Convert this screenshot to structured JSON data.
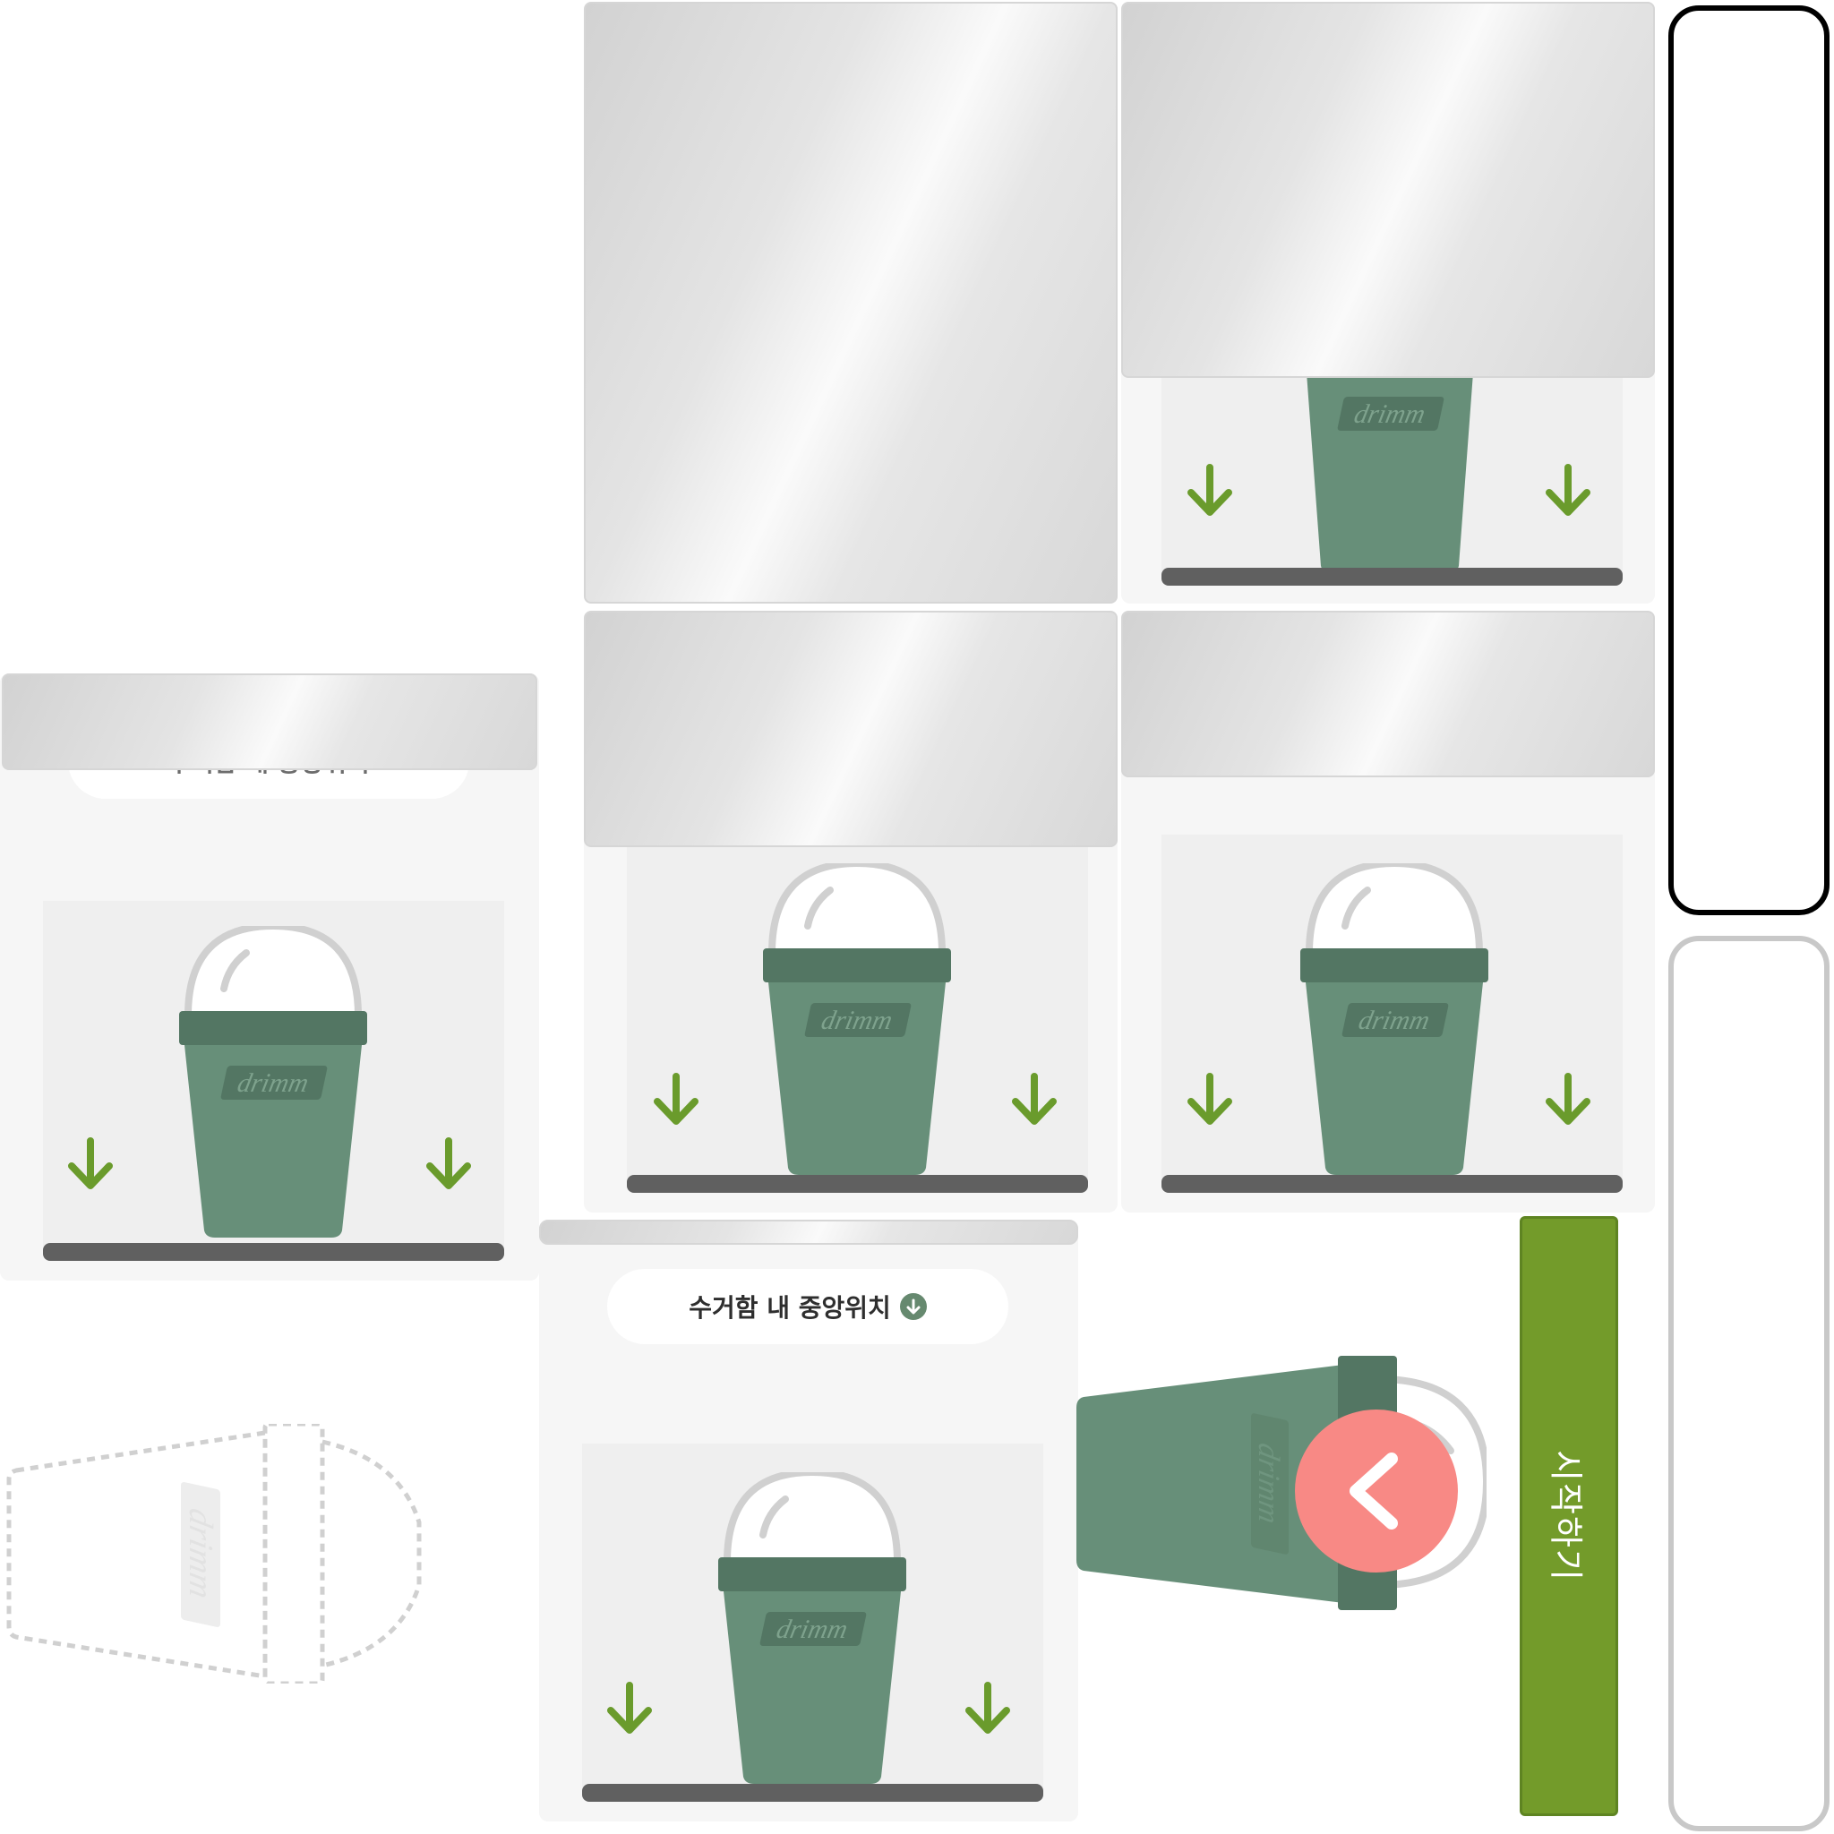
{
  "colors": {
    "accent_green": "#739b2a",
    "cup_green": "#678f79",
    "cup_band": "#537663",
    "arrow_green": "#6a9b2c",
    "shelf": "#606060",
    "back_button": "#f88985"
  },
  "cup": {
    "logo": "drimm"
  },
  "instruction": {
    "caption": "수거함 내 중앙위치",
    "caption_icon": "arrow-down-circle-icon"
  },
  "hidden_caption_fragment": "수거함 내 중앙위치",
  "start_button": {
    "label": "시작하기"
  },
  "back_button": {
    "icon": "chevron-left-icon"
  },
  "icons": [
    "arrow-down-icon",
    "chevron-left-icon",
    "arrow-down-circle-icon"
  ]
}
